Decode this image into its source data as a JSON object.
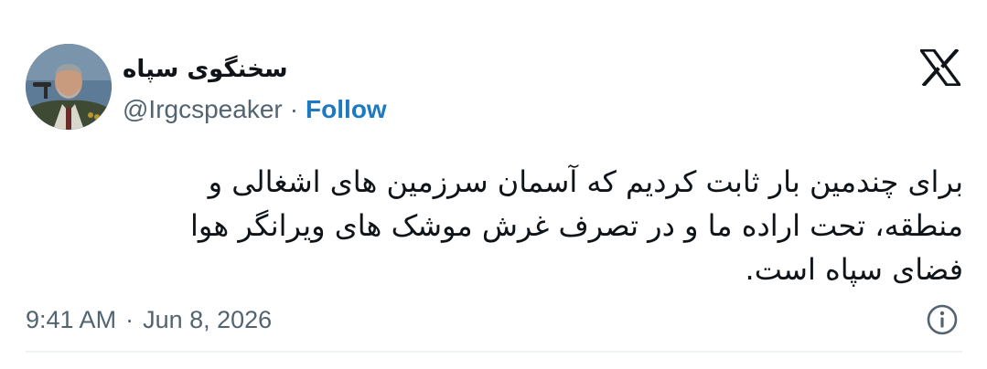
{
  "author": {
    "display_name": "سخنگوی سپاه",
    "handle": "@Irgcspeaker",
    "separator": "·",
    "follow_label": "Follow"
  },
  "tweet": {
    "text": "برای چندمین بار ثابت کردیم که آسمان سرزمین های اشغالی و\nمنطقه، تحت اراده ما و در تصرف غرش موشک های ویرانگر هوا\nفضای سپاه است."
  },
  "meta": {
    "time": "9:41 AM",
    "separator": "·",
    "date": "Jun 8, 2026"
  },
  "icons": {
    "brand": "x-logo-icon",
    "info": "info-icon",
    "avatar": "profile-photo"
  },
  "colors": {
    "text": "#0f1419",
    "secondary": "#536471",
    "follow": "#1d79c2",
    "divider": "#eff3f4"
  }
}
